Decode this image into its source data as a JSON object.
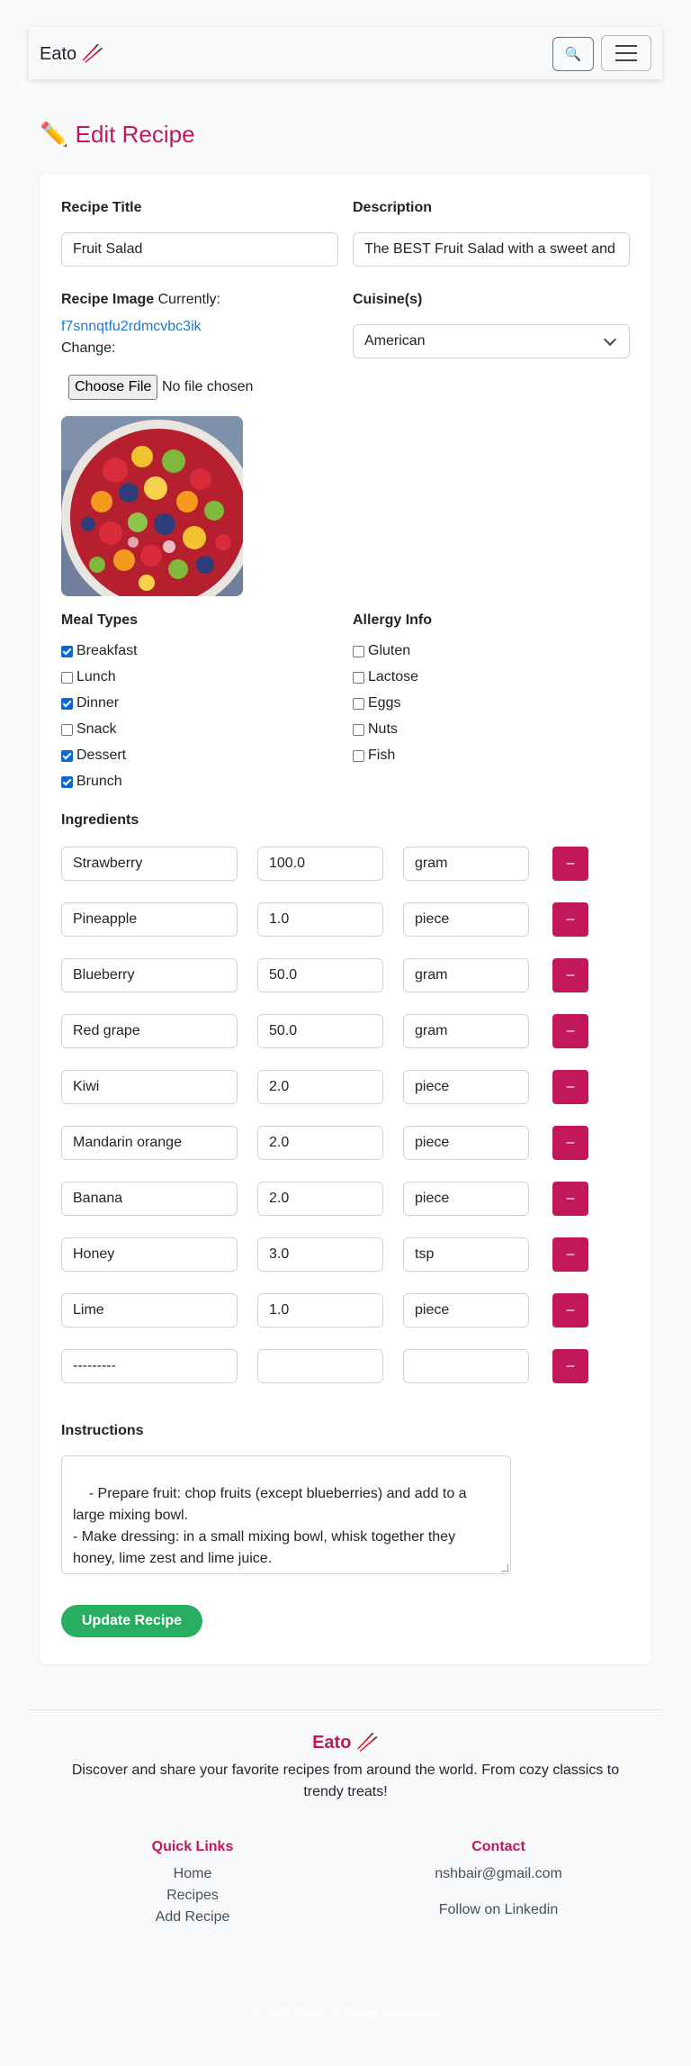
{
  "navbar": {
    "brand": "Eato 🥢",
    "search_icon": "🔍",
    "menu_icon": "hamburger-icon"
  },
  "page": {
    "title": "✏️ Edit Recipe"
  },
  "form": {
    "title_label": "Recipe Title",
    "title_value": "Fruit Salad",
    "description_label": "Description",
    "description_value": "The BEST Fruit Salad with a sweet and",
    "image_label": "Recipe Image",
    "currently_text": "Currently:",
    "current_file": "f7snnqtfu2rdmcvbc3ik",
    "change_text": "Change:",
    "choose_file_label": "Choose File",
    "no_file_text": "No file chosen",
    "cuisine_label": "Cuisine(s)",
    "cuisine_value": "American",
    "meal_types_label": "Meal Types",
    "meal_types": [
      {
        "label": "Breakfast",
        "checked": true
      },
      {
        "label": "Lunch",
        "checked": false
      },
      {
        "label": "Dinner",
        "checked": true
      },
      {
        "label": "Snack",
        "checked": false
      },
      {
        "label": "Dessert",
        "checked": true
      },
      {
        "label": "Brunch",
        "checked": true
      }
    ],
    "allergy_label": "Allergy Info",
    "allergies": [
      {
        "label": "Gluten",
        "checked": false
      },
      {
        "label": "Lactose",
        "checked": false
      },
      {
        "label": "Eggs",
        "checked": false
      },
      {
        "label": "Nuts",
        "checked": false
      },
      {
        "label": "Fish",
        "checked": false
      }
    ],
    "ingredients_label": "Ingredients",
    "ingredients": [
      {
        "name": "Strawberry",
        "qty": "100.0",
        "unit": "gram"
      },
      {
        "name": "Pineapple",
        "qty": "1.0",
        "unit": "piece"
      },
      {
        "name": "Blueberry",
        "qty": "50.0",
        "unit": "gram"
      },
      {
        "name": "Red grape",
        "qty": "50.0",
        "unit": "gram"
      },
      {
        "name": "Kiwi",
        "qty": "2.0",
        "unit": "piece"
      },
      {
        "name": "Mandarin orange",
        "qty": "2.0",
        "unit": "piece"
      },
      {
        "name": "Banana",
        "qty": "2.0",
        "unit": "piece"
      },
      {
        "name": "Honey",
        "qty": "3.0",
        "unit": "tsp"
      },
      {
        "name": "Lime",
        "qty": "1.0",
        "unit": "piece"
      },
      {
        "name": "---------",
        "qty": "",
        "unit": ""
      }
    ],
    "remove_label": "–",
    "instructions_label": "Instructions",
    "instructions_value": "- Prepare fruit: chop fruits (except blueberries) and add to a large mixing bowl.\n- Make dressing: in a small mixing bowl, whisk together they honey, lime zest and lime juice.\n- Toss fruit with dressing: pour dressing over fruit just before serving and toss to coat.",
    "submit_label": "Update Recipe"
  },
  "footer": {
    "brand": "Eato 🥢",
    "tagline": "Discover and share your favorite recipes from around the world. From cozy classics to trendy treats!",
    "quick_links_title": "Quick Links",
    "quick_links": [
      "Home",
      "Recipes",
      "Add Recipe"
    ],
    "contact_title": "Contact",
    "email": "nshbair@gmail.com",
    "linkedin": "Follow on Linkedin",
    "copyright": "© 2025 Eato. All Rights Reserved."
  },
  "colors": {
    "accent": "#c2185b",
    "success": "#27ae60",
    "link": "#1f7acb",
    "checkbox": "#0b66d6"
  }
}
